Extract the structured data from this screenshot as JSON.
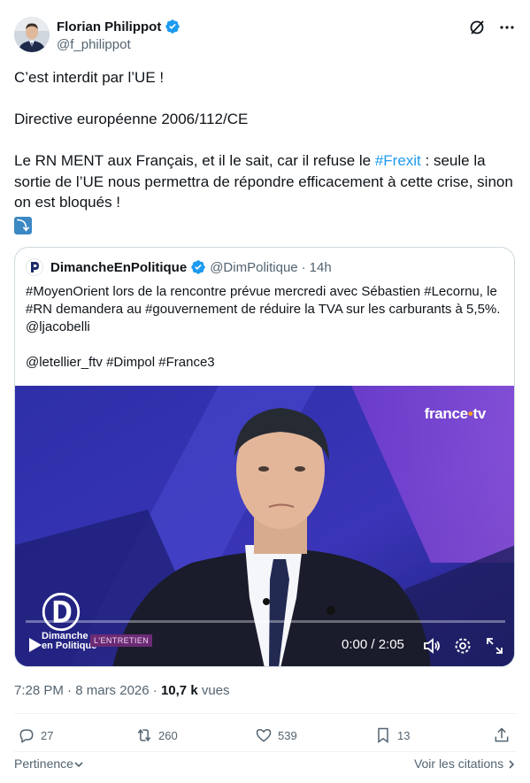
{
  "author": {
    "name": "Florian Philippot",
    "handle": "@f_philippot"
  },
  "tweet": {
    "line1": "C’est interdit par l’UE !",
    "line2": "Directive européenne 2006/112/CE",
    "line3_pre": "Le RN MENT aux Français, et il le sait, car il refuse le ",
    "line3_hashtag": "#Frexit",
    "line3_post": " : seule la sortie de l’UE nous permettra de répondre efficacement à cette crise, sinon on est bloqués !",
    "emoji": "⤵"
  },
  "quote": {
    "name": "DimancheEnPolitique",
    "handle": "@DimPolitique",
    "sep": "·",
    "time": "14h",
    "text": "#MoyenOrient lors de la rencontre prévue mercredi avec Sébastien #Lecornu, le #RN demandera au #gouvernement de réduire la TVA sur les carburants à 5,5%. @ljacobelli\n\n@letellier_ftv #Dimpol #France3",
    "video": {
      "brand": "france",
      "brand_suffix": "tv",
      "logo_line1": "Dimanche",
      "logo_line2": "en Politique",
      "tag": "L'ENTRETIEN",
      "time": "0:00 / 2:05"
    }
  },
  "meta": {
    "time": "7:28 PM",
    "sep": "·",
    "date": "8 mars 2026",
    "views_count": "10,7 k",
    "views_label": " vues"
  },
  "actions": {
    "replies": "27",
    "reposts": "260",
    "likes": "539",
    "bookmarks": "13"
  },
  "footer": {
    "sort": "Pertinence",
    "quotes": "Voir les citations"
  },
  "colors": {
    "accent": "#1d9bf0",
    "text": "#0f1419",
    "secondary": "#536471",
    "border": "#cfd9de"
  }
}
